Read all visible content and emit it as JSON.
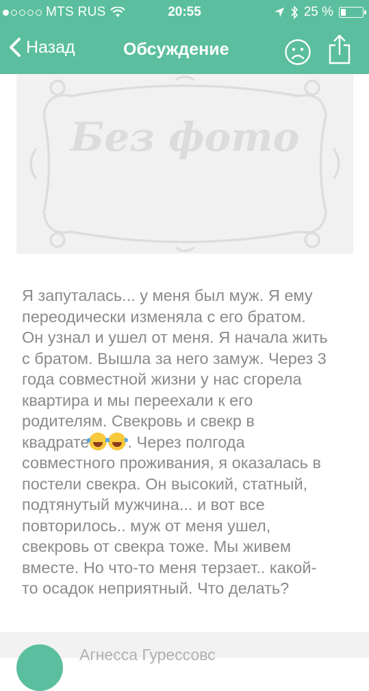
{
  "status_bar": {
    "carrier": "MTS RUS",
    "time": "20:55",
    "battery_percent": "25 %",
    "signal_bars_filled": 1,
    "signal_bars_total": 5,
    "battery_level": 0.25
  },
  "nav": {
    "back_label": "Назад",
    "title": "Обсуждение",
    "reaction_icon": "sad-face-icon",
    "share_icon": "share-icon"
  },
  "photo": {
    "placeholder_text": "Без фото"
  },
  "post": {
    "lines": [
      "Я запуталась... у меня был муж. Я ему",
      "переодически изменяла с его братом.",
      "Он узнал и ушел от меня. Я начала жить",
      "с братом. Вышла за него замуж. Через 3",
      "года совместной жизни у нас сгорела",
      "квартира и мы переехали к его",
      "родителям. Свекровь и свекр в",
      "квадрате",
      ". Через полгода",
      "совместного проживания, я оказалась в",
      "постели свекра. Он высокий, статный,",
      "подтянутый мужчина... и вот все",
      "повторилось.. муж от меня ушел,",
      "свекровь от свекра тоже. Мы живем",
      "вместе. Но что-то меня терзает.. какой-",
      "то осадок неприятный. Что делать?"
    ],
    "emoji": "face-with-tears-of-joy-emoji"
  },
  "comment": {
    "author": "Агнесса Гурессовс"
  },
  "colors": {
    "accent": "#5bbf9f",
    "text": "#8a8a8a",
    "placeholder_bg": "#f1f1f1"
  }
}
